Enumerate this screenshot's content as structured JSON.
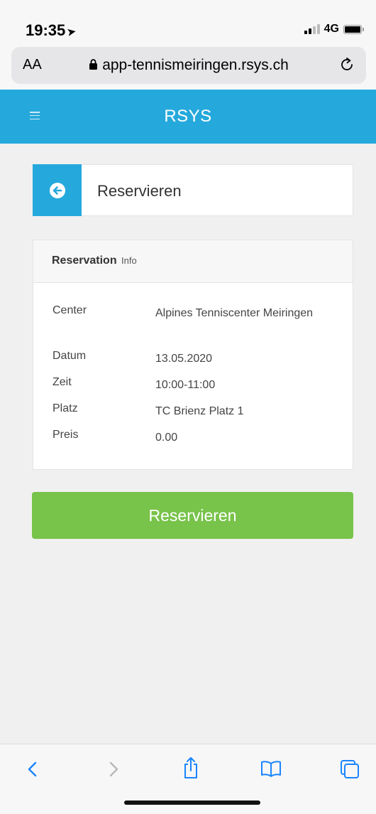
{
  "status_bar": {
    "time": "19:35",
    "network": "4G"
  },
  "browser": {
    "text_size_label": "AA",
    "url": "app-tennismeiringen.rsys.ch"
  },
  "app": {
    "title": "RSYS"
  },
  "page": {
    "title": "Reservieren"
  },
  "panel": {
    "heading": "Reservation",
    "heading_sub": "Info",
    "rows": [
      {
        "label": "Center",
        "value": "Alpines Tenniscenter Meiringen"
      },
      {
        "label": "Datum",
        "value": "13.05.2020"
      },
      {
        "label": "Zeit",
        "value": "10:00-11:00"
      },
      {
        "label": "Platz",
        "value": "TC Brienz Platz 1"
      },
      {
        "label": "Preis",
        "value": "0.00"
      }
    ]
  },
  "action": {
    "label": "Reservieren"
  },
  "colors": {
    "primary": "#25a9dc",
    "success": "#78c34a"
  }
}
